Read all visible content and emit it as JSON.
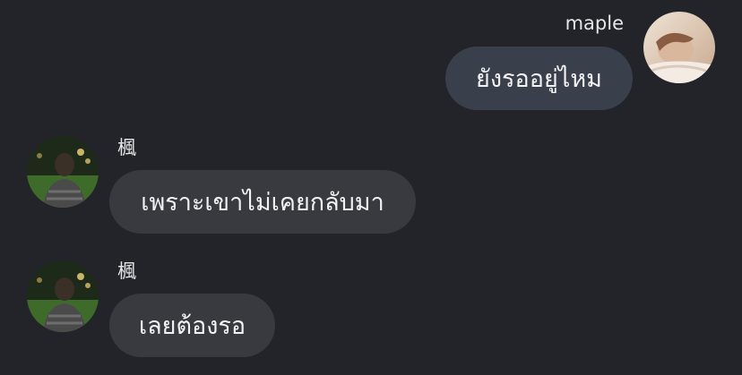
{
  "messages": [
    {
      "sender": "maple",
      "direction": "outgoing",
      "text": "ยังรออยู่ไหม",
      "avatar_icon": "profile-photo-icon"
    },
    {
      "sender": "楓",
      "direction": "incoming",
      "text": "เพราะเขาไม่เคยกลับมา",
      "avatar_icon": "profile-photo-icon"
    },
    {
      "sender": "楓",
      "direction": "incoming",
      "text": "เลยต้องรอ",
      "avatar_icon": "profile-photo-icon"
    }
  ],
  "colors": {
    "background": "#232429",
    "outgoing_bubble": "#3a3f4c",
    "incoming_bubble": "#393a40",
    "text": "#f2f2f4"
  }
}
